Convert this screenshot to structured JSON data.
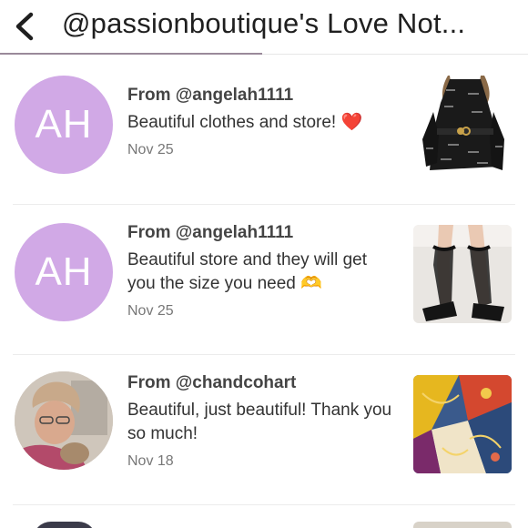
{
  "header": {
    "title": "@passionboutique's Love Not..."
  },
  "notes": [
    {
      "from": "From @angelah1111",
      "message": "Beautiful clothes and store! ❤️",
      "date": "Nov 25",
      "avatar_initials": "AH",
      "avatar_color": "#d1a9e6"
    },
    {
      "from": "From @angelah1111",
      "message": "Beautiful store and they will get you the size you need 🫶",
      "date": "Nov 25",
      "avatar_initials": "AH",
      "avatar_color": "#d1a9e6"
    },
    {
      "from": "From @chandcohart",
      "message": "Beautiful, just beautiful! Thank you so much!",
      "date": "Nov 18"
    }
  ],
  "icons": {
    "back": "chevron-left-icon"
  }
}
